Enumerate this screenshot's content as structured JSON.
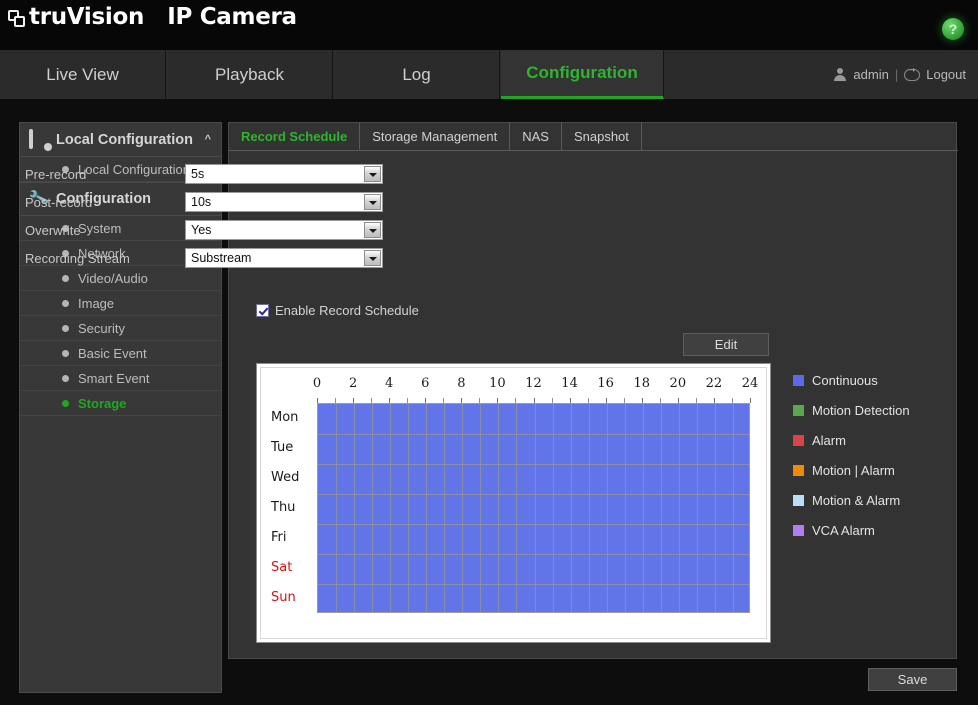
{
  "banner": {
    "brand_tru": "truVision",
    "brand_product": "IP Camera",
    "help_glyph": "?"
  },
  "nav": {
    "tabs": [
      {
        "label": "Live View",
        "active": false
      },
      {
        "label": "Playback",
        "active": false
      },
      {
        "label": "Log",
        "active": false
      },
      {
        "label": "Configuration",
        "active": true
      }
    ],
    "user": "admin",
    "separator": "|",
    "logout": "Logout"
  },
  "sidebar": {
    "groups": [
      {
        "title": "Local Configuration",
        "icon": "monitor-gear-icon",
        "chevron": "^",
        "items": [
          {
            "label": "Local Configuration",
            "active": false
          }
        ]
      },
      {
        "title": "Configuration",
        "icon": "wrench-icon",
        "chevron": "^",
        "items": [
          {
            "label": "System",
            "active": false
          },
          {
            "label": "Network",
            "active": false
          },
          {
            "label": "Video/Audio",
            "active": false
          },
          {
            "label": "Image",
            "active": false
          },
          {
            "label": "Security",
            "active": false
          },
          {
            "label": "Basic Event",
            "active": false
          },
          {
            "label": "Smart Event",
            "active": false
          },
          {
            "label": "Storage",
            "active": true
          }
        ]
      }
    ]
  },
  "content": {
    "tabs": [
      {
        "label": "Record Schedule",
        "active": true
      },
      {
        "label": "Storage Management",
        "active": false
      },
      {
        "label": "NAS",
        "active": false
      },
      {
        "label": "Snapshot",
        "active": false
      }
    ],
    "form": [
      {
        "label": "Pre-record",
        "value": "5s"
      },
      {
        "label": "Post-record",
        "value": "10s"
      },
      {
        "label": "Overwrite",
        "value": "Yes"
      },
      {
        "label": "Recording Stream",
        "value": "Substream"
      }
    ],
    "enable_checkbox": {
      "label": "Enable Record Schedule",
      "checked": true
    },
    "edit_button": "Edit",
    "save_button": "Save"
  },
  "schedule": {
    "hours": [
      "0",
      "2",
      "4",
      "6",
      "8",
      "10",
      "12",
      "14",
      "16",
      "18",
      "20",
      "22",
      "24"
    ],
    "days": [
      {
        "label": "Mon",
        "weekend": false
      },
      {
        "label": "Tue",
        "weekend": false
      },
      {
        "label": "Wed",
        "weekend": false
      },
      {
        "label": "Thu",
        "weekend": false
      },
      {
        "label": "Fri",
        "weekend": false
      },
      {
        "label": "Sat",
        "weekend": true
      },
      {
        "label": "Sun",
        "weekend": true
      }
    ],
    "fill_color": "#6275e8",
    "fill_type": "Continuous",
    "coverage": "00:00-24:00 all days"
  },
  "legend": [
    {
      "label": "Continuous",
      "color": "#5a6ae8"
    },
    {
      "label": "Motion Detection",
      "color": "#5aa84e"
    },
    {
      "label": "Alarm",
      "color": "#d9434a"
    },
    {
      "label": "Motion | Alarm",
      "color": "#ef8b07"
    },
    {
      "label": "Motion & Alarm",
      "color": "#b9dff5"
    },
    {
      "label": "VCA Alarm",
      "color": "#b playback"
    }
  ],
  "legend_colors": [
    "#5a6ae8",
    "#5aa84e",
    "#d9434a",
    "#ef8b07",
    "#b9dff5",
    "#b07ef0"
  ]
}
